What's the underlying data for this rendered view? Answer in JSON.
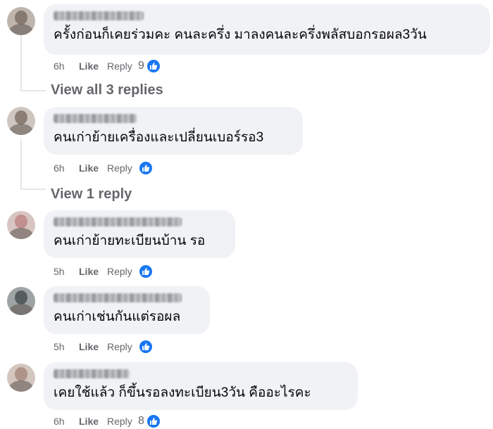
{
  "comments": [
    {
      "text": "ครั้งก่อนก็เคยร่วมคะ คนละครึ่ง มาลงคนละครึ่งพลัสบอกรอผล3วัน",
      "time": "6h",
      "like": "Like",
      "reply": "Reply",
      "reactions": "9"
    },
    {
      "text": "คนเก่าย้ายเครื่องและเปลี่ยนเบอร์รอ3",
      "time": "6h",
      "like": "Like",
      "reply": "Reply",
      "reactions": ""
    },
    {
      "text": "คนเก่าย้ายทะเบียนบ้าน รอ",
      "time": "5h",
      "like": "Like",
      "reply": "Reply",
      "reactions": ""
    },
    {
      "text": "คนเก่าเช่นกันแต่รอผล",
      "time": "5h",
      "like": "Like",
      "reply": "Reply",
      "reactions": ""
    },
    {
      "text": "เคยใช้แล้ว ก็ขึ้นรอลงทะเบียน3วัน คืออะไรคะ",
      "time": "6h",
      "like": "Like",
      "reply": "Reply",
      "reactions": "8"
    }
  ],
  "view_replies": [
    "View all 3 replies",
    "View 1 reply"
  ],
  "colors": {
    "bubble": "#f0f2f5",
    "meta_text": "#65676b",
    "like_blue": "#1877f2",
    "thread_line": "#e4e6eb"
  },
  "icons": [
    "avatar",
    "like-thumb-icon"
  ]
}
